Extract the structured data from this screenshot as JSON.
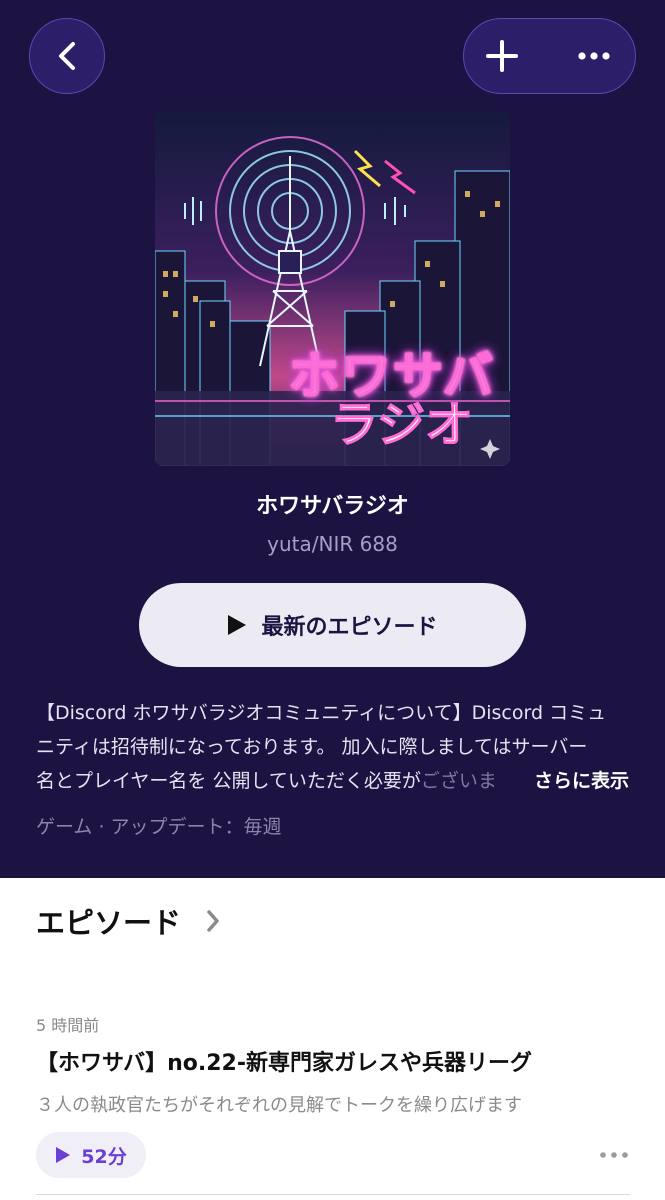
{
  "header": {
    "background": "#1c1342",
    "back_icon": "chevron-left-icon",
    "add_icon": "plus-icon",
    "more_icon": "ellipsis-icon"
  },
  "podcast": {
    "artwork_text_line1": "ホワサバ",
    "artwork_text_line2": "ラジオ",
    "title": "ホワサバラジオ",
    "author": "yuta/NIR 688",
    "play_latest_label": "最新のエピソード",
    "description_line1": "【Discord ホワサバラジオコミュニティについて】Discord コミュ",
    "description_line2": "ニティは招待制になっております。 加入に際しましてはサーバー",
    "description_line3_a": "名とプレイヤー名を 公開していただく必要が",
    "description_line3_b": "ございま",
    "more_label": "さらに表示",
    "meta": "ゲーム · アップデート：毎週"
  },
  "episodes_section": {
    "title": "エピソード",
    "items": [
      {
        "time_ago": "5 時間前",
        "title": "【ホワサバ】no.22-新専門家ガレスや兵器リーグ",
        "summary": "３人の執政官たちがそれぞれの見解でトークを繰り広げます",
        "duration": "52分"
      }
    ]
  },
  "colors": {
    "accent": "#6a3fd4",
    "button_ring": "#5c47b3"
  }
}
